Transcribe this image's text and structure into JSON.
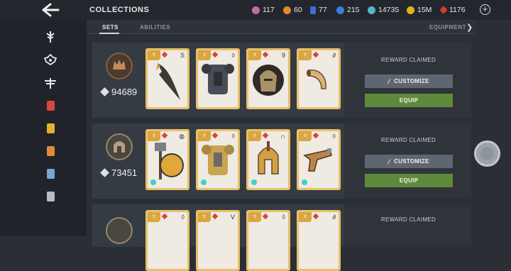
{
  "header": {
    "title": "COLLECTIONS",
    "currencies": [
      {
        "icon": "pearl-icon",
        "value": "117",
        "color": "#c76aa8"
      },
      {
        "icon": "coin-blue-icon",
        "value": "60",
        "color": "#e08a2a"
      },
      {
        "icon": "card-icon",
        "value": "77",
        "color": "#3b6fd1"
      },
      {
        "icon": "shield-token-icon",
        "value": "215",
        "color": "#3a7fd6"
      },
      {
        "icon": "swirl-icon",
        "value": "14735",
        "color": "#5ab3c9"
      },
      {
        "icon": "gold-coin-icon",
        "value": "15M",
        "color": "#e4b21c"
      },
      {
        "icon": "ruby-icon",
        "value": "1176",
        "color": "#d83b30"
      }
    ]
  },
  "tabs": [
    {
      "label": "SETS",
      "active": true
    },
    {
      "label": "ABILITIES",
      "active": false
    },
    {
      "label": "EQUIPMENT",
      "active": false
    }
  ],
  "sets": [
    {
      "power": "94689",
      "emblem_color": "#8a6040",
      "status": "REWARD CLAIMED",
      "customize_label": "CUSTOMIZE",
      "equip_label": "EQUIP",
      "items": [
        {
          "name": "curved-blade-icon",
          "mod": "S"
        },
        {
          "name": "dark-armor-icon",
          "mod": "◊"
        },
        {
          "name": "lion-helm-icon",
          "mod": "9"
        },
        {
          "name": "horn-icon",
          "mod": "∂"
        }
      ]
    },
    {
      "power": "73451",
      "emblem_color": "#7a6a56",
      "status": "REWARD CLAIMED",
      "customize_label": "CUSTOMIZE",
      "equip_label": "EQUIP",
      "items": [
        {
          "name": "hammer-shield-icon",
          "mod": "◍"
        },
        {
          "name": "golden-armor-icon",
          "mod": "◊"
        },
        {
          "name": "spartan-helm-icon",
          "mod": "∩"
        },
        {
          "name": "ornate-gun-icon",
          "mod": "◊"
        }
      ]
    },
    {
      "power": "",
      "emblem_color": "#7a6a56",
      "status": "REWARD CLAIMED",
      "customize_label": "",
      "equip_label": "",
      "items": [
        {
          "name": "item-icon",
          "mod": "◊"
        },
        {
          "name": "item-icon",
          "mod": "V"
        },
        {
          "name": "item-icon",
          "mod": "◊"
        },
        {
          "name": "item-icon",
          "mod": "∂"
        }
      ]
    }
  ],
  "sidebar": [
    {
      "name": "weapon-category-icon",
      "color": "#e8e8e8"
    },
    {
      "name": "set-category-icon",
      "color": "#e8e8e8"
    },
    {
      "name": "dragonfly-category-icon",
      "color": "#e8e8e8"
    },
    {
      "name": "red-card-icon",
      "color": "#d8473c"
    },
    {
      "name": "yellow-card-icon",
      "color": "#e8b02a"
    },
    {
      "name": "orange-card-icon",
      "color": "#e08a3c"
    },
    {
      "name": "blue-card-icon",
      "color": "#7aa4d6"
    },
    {
      "name": "grey-card-icon",
      "color": "#b8bcc2"
    }
  ]
}
